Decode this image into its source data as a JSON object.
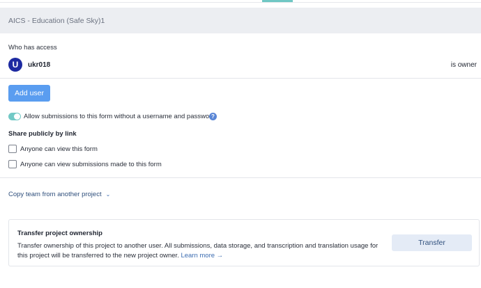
{
  "header": {
    "title": "AICS - Education (Safe Sky)1"
  },
  "access": {
    "section_label": "Who has access",
    "users": [
      {
        "avatar_letter": "U",
        "username": "ukr018",
        "role": "is owner"
      }
    ],
    "add_user_label": "Add user"
  },
  "anonymous_submissions": {
    "label": "Allow submissions to this form without a username and password",
    "enabled": true,
    "help_icon": "question-circle-icon"
  },
  "share_publicly": {
    "heading": "Share publicly by link",
    "options": [
      {
        "label": "Anyone can view this form",
        "checked": false
      },
      {
        "label": "Anyone can view submissions made to this form",
        "checked": false
      }
    ]
  },
  "copy_team": {
    "label": "Copy team from another project",
    "icon": "chevron-down-icon"
  },
  "transfer": {
    "title": "Transfer project ownership",
    "description": "Transfer ownership of this project to another user. All submissions, data storage, and transcription and translation usage for this project will be transferred to the new project owner.",
    "learn_more_label": "Learn more →",
    "button_label": "Transfer"
  },
  "colors": {
    "accent": "#5a9df0",
    "toggle_on": "#72c9c6",
    "avatar": "#1d2aa1",
    "link": "#3a6bb0"
  }
}
